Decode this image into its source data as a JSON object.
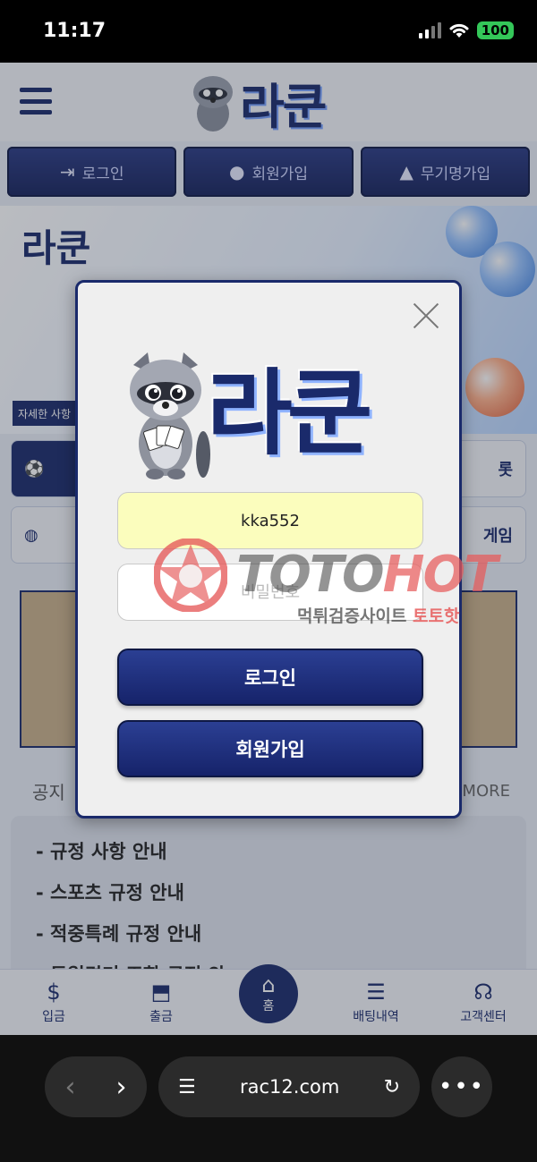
{
  "status_bar": {
    "time": "11:17",
    "battery": "100"
  },
  "header": {
    "logo_text": "라쿤"
  },
  "auth_buttons": [
    {
      "label": "로그인",
      "icon": "sign-in-icon"
    },
    {
      "label": "회원가입",
      "icon": "user-icon"
    },
    {
      "label": "무기명가입",
      "icon": "incognito-icon"
    }
  ],
  "banner": {
    "logo_text": "라쿤",
    "caption": "자세한 사항"
  },
  "games": {
    "row1_right": "롯",
    "row2_right": "게임"
  },
  "notice": {
    "title": "공지",
    "more": "MORE",
    "items": [
      "- 규정 사항 안내",
      "- 스포츠 규정 안내",
      "- 적중특례 규정 안내",
      "- 동일경기 조합 규정 안"
    ]
  },
  "bottom_nav": [
    {
      "label": "입금",
      "icon": "deposit-icon"
    },
    {
      "label": "출금",
      "icon": "withdraw-icon"
    },
    {
      "label": "홈",
      "icon": "home-icon"
    },
    {
      "label": "배팅내역",
      "icon": "betting-history-icon"
    },
    {
      "label": "고객센터",
      "icon": "headset-icon"
    }
  ],
  "modal": {
    "logo_text": "라쿤",
    "username_value": "kka552",
    "password_placeholder": "비밀번호",
    "login_label": "로그인",
    "join_label": "회원가입"
  },
  "watermark": {
    "brand_a": "TOTO",
    "brand_b": "HOT",
    "sub_a": "먹튀검증사이트 ",
    "sub_b": "토토핫"
  },
  "browser": {
    "url": "rac12.com"
  },
  "colors": {
    "brand_navy": "#1a2a6b",
    "input_highlight": "#fbfdbd",
    "watermark_red": "#e65a5a"
  }
}
